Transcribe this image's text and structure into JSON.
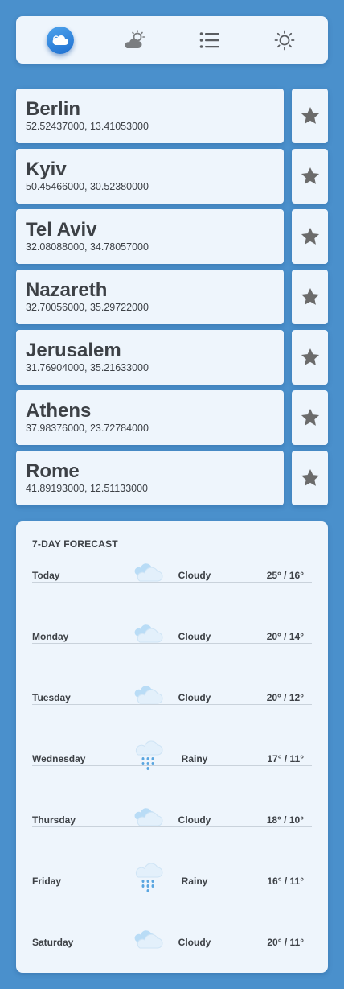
{
  "nav": {
    "items": [
      {
        "name": "nav-weather-app",
        "icon": "cloud-sun-icon"
      },
      {
        "name": "nav-forecast",
        "icon": "partly-cloudy-icon"
      },
      {
        "name": "nav-list",
        "icon": "list-icon"
      },
      {
        "name": "nav-settings",
        "icon": "sun-icon"
      }
    ]
  },
  "cities": [
    {
      "name": "Berlin",
      "coords": "52.52437000, 13.41053000"
    },
    {
      "name": "Kyiv",
      "coords": "50.45466000, 30.52380000"
    },
    {
      "name": "Tel Aviv",
      "coords": "32.08088000, 34.78057000"
    },
    {
      "name": "Nazareth",
      "coords": "32.70056000, 35.29722000"
    },
    {
      "name": "Jerusalem",
      "coords": "31.76904000, 35.21633000"
    },
    {
      "name": "Athens",
      "coords": "37.98376000, 23.72784000"
    },
    {
      "name": "Rome",
      "coords": "41.89193000, 12.51133000"
    }
  ],
  "forecast": {
    "title": "7-DAY FORECAST",
    "days": [
      {
        "day": "Today",
        "condition": "Cloudy",
        "icon": "cloudy-icon",
        "temps": "25° / 16°"
      },
      {
        "day": "Monday",
        "condition": "Cloudy",
        "icon": "cloudy-icon",
        "temps": "20° / 14°"
      },
      {
        "day": "Tuesday",
        "condition": "Cloudy",
        "icon": "cloudy-icon",
        "temps": "20° / 12°"
      },
      {
        "day": "Wednesday",
        "condition": "Rainy",
        "icon": "rainy-icon",
        "temps": "17° / 11°"
      },
      {
        "day": "Thursday",
        "condition": "Cloudy",
        "icon": "cloudy-icon",
        "temps": "18° / 10°"
      },
      {
        "day": "Friday",
        "condition": "Rainy",
        "icon": "rainy-icon",
        "temps": "16° / 11°"
      },
      {
        "day": "Saturday",
        "condition": "Cloudy",
        "icon": "cloudy-icon",
        "temps": "20° / 11°"
      }
    ]
  },
  "colors": {
    "background": "#4a90cc",
    "card": "#eef5fc",
    "accent": "#1e6fd0",
    "text": "#3d4146",
    "star": "#6b6b6b"
  }
}
